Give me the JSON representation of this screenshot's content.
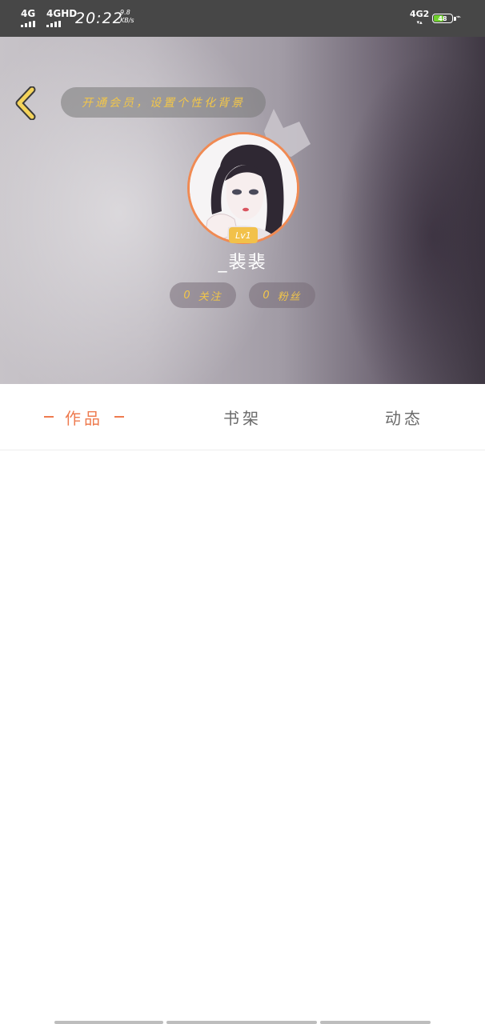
{
  "status_bar": {
    "net1": "4G",
    "net2": "4GHD",
    "time": "20:22",
    "speed_value": "9.8",
    "speed_unit": "KB/s",
    "right_net": "4G2",
    "battery_level": "48",
    "battery_color": "#6fd12d"
  },
  "header": {
    "promo_text": "开通会员，设置个性化背景",
    "level": "Lv1",
    "username": "_裴裴",
    "following_count": "0",
    "following_label": "关注",
    "fans_count": "0",
    "fans_label": "粉丝"
  },
  "tabs": {
    "works": "作品",
    "bookshelf": "书架",
    "activity": "动态"
  },
  "colors": {
    "accent": "#ee7b4f",
    "gold": "#f2c64a"
  }
}
